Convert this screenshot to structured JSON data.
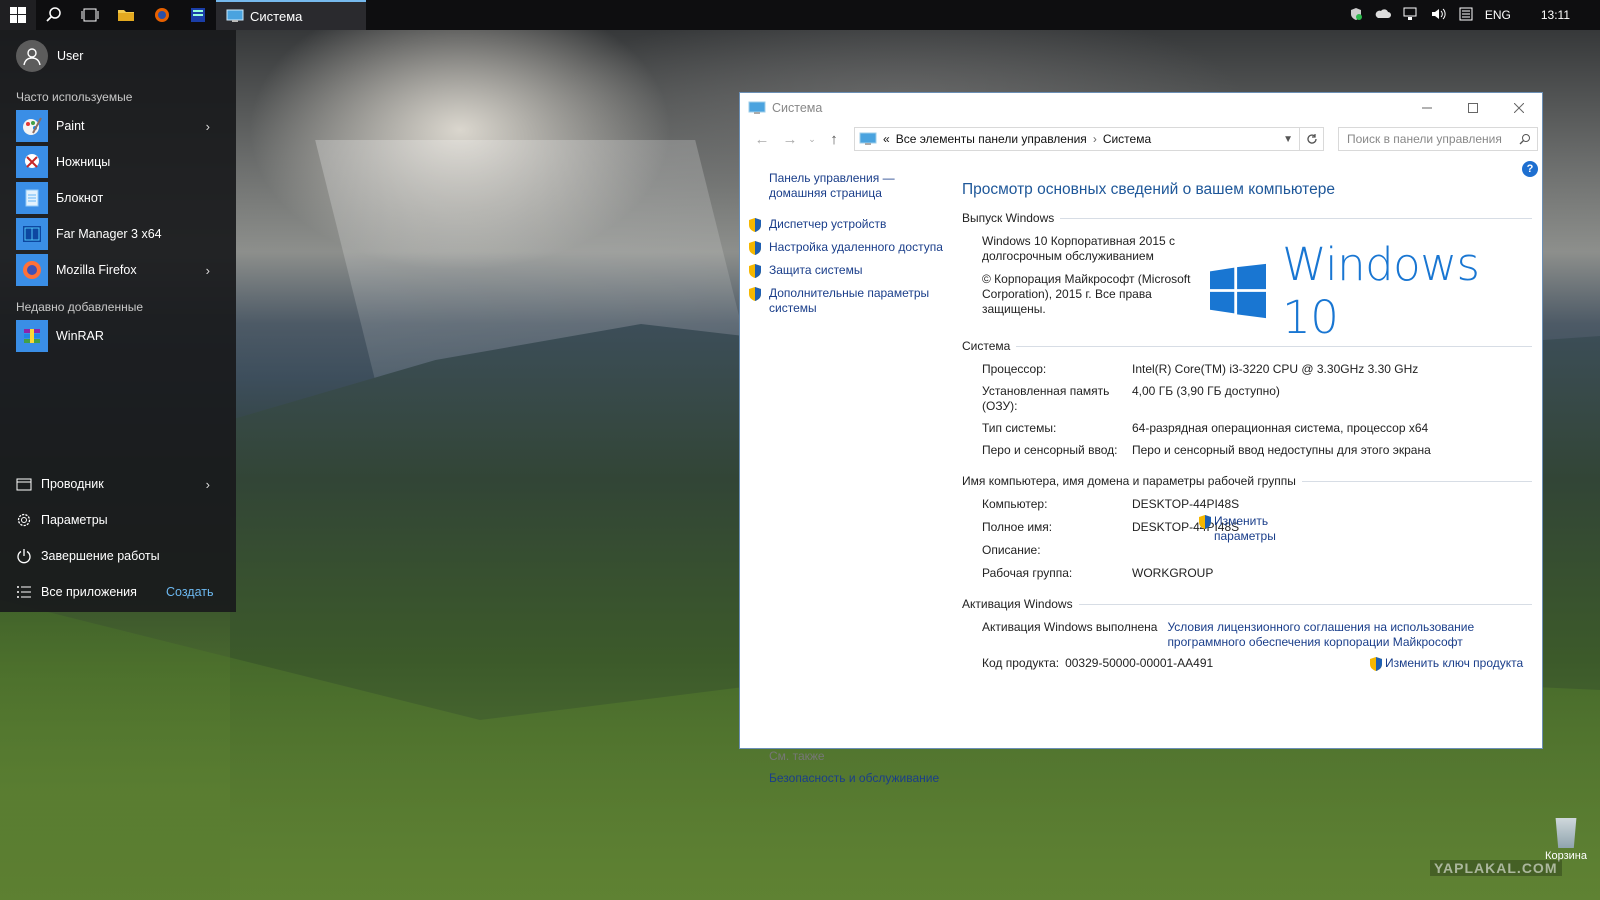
{
  "taskbar": {
    "active_app_label": "Система",
    "tray_language": "ENG",
    "tray_clock": "13:11"
  },
  "start_menu": {
    "user_name": "User",
    "frequent_heading": "Часто используемые",
    "frequent_items": [
      {
        "label": "Paint",
        "icon": "paint-icon",
        "has_arrow": true
      },
      {
        "label": "Ножницы",
        "icon": "snipping-tool-icon",
        "has_arrow": false
      },
      {
        "label": "Блокнот",
        "icon": "notepad-icon",
        "has_arrow": false
      },
      {
        "label": "Far Manager 3 x64",
        "icon": "far-manager-icon",
        "has_arrow": false
      },
      {
        "label": "Mozilla Firefox",
        "icon": "firefox-icon",
        "has_arrow": true
      }
    ],
    "recent_heading": "Недавно добавленные",
    "recent_items": [
      {
        "label": "WinRAR",
        "icon": "winrar-icon"
      }
    ],
    "system_items": [
      {
        "label": "Проводник",
        "icon": "file-explorer-icon",
        "has_arrow": true
      },
      {
        "label": "Параметры",
        "icon": "settings-gear-icon",
        "has_arrow": false
      },
      {
        "label": "Завершение работы",
        "icon": "power-icon",
        "has_arrow": false
      },
      {
        "label": "Все приложения",
        "icon": "all-apps-icon",
        "has_arrow": false
      }
    ],
    "create_label": "Создать"
  },
  "window": {
    "title": "Система",
    "breadcrumb_prefix": "«",
    "breadcrumb": [
      "Все элементы панели управления",
      "Система"
    ],
    "search_placeholder": "Поиск в панели управления",
    "help_label": "?",
    "left_pane": {
      "home_link": "Панель управления — домашняя страница",
      "links": [
        "Диспетчер устройств",
        "Настройка удаленного доступа",
        "Защита системы",
        "Дополнительные параметры системы"
      ],
      "see_also_heading": "См. также",
      "see_also_link": "Безопасность и обслуживание"
    },
    "main_title": "Просмотр основных сведений о вашем компьютере",
    "edition": {
      "heading": "Выпуск Windows",
      "name": "Windows 10 Корпоративная 2015 с долгосрочным обслуживанием",
      "copyright": "© Корпорация Майкрософт (Microsoft Corporation), 2015 г. Все права защищены.",
      "logo_text": "Windows 10"
    },
    "system": {
      "heading": "Система",
      "rows": [
        {
          "key": "Процессор:",
          "value": "Intel(R) Core(TM) i3-3220 CPU @ 3.30GHz   3.30 GHz"
        },
        {
          "key": "Установленная память (ОЗУ):",
          "value": "4,00 ГБ (3,90 ГБ доступно)"
        },
        {
          "key": "Тип системы:",
          "value": "64-разрядная операционная система, процессор x64"
        },
        {
          "key": "Перо и сенсорный ввод:",
          "value": "Перо и сенсорный ввод недоступны для этого экрана"
        }
      ]
    },
    "computer": {
      "heading": "Имя компьютера, имя домена и параметры рабочей группы",
      "rows": [
        {
          "key": "Компьютер:",
          "value": "DESKTOP-44PI48S"
        },
        {
          "key": "Полное имя:",
          "value": "DESKTOP-44PI48S"
        },
        {
          "key": "Описание:",
          "value": ""
        },
        {
          "key": "Рабочая группа:",
          "value": "WORKGROUP"
        }
      ],
      "change_link": "Изменить параметры"
    },
    "activation": {
      "heading": "Активация Windows",
      "status": "Активация Windows выполнена",
      "license_link": "Условия лицензионного соглашения на использование программного обеспечения корпорации Майкрософт",
      "product_key_label": "Код продукта:",
      "product_key": "00329-50000-00001-AA491",
      "change_key_link": "Изменить ключ продукта"
    }
  },
  "desktop": {
    "recycle_bin_label": "Корзина",
    "watermark": "YAPLAKAL.COM"
  },
  "colors": {
    "accent": "#1e5799",
    "link": "#1a3e8a",
    "windows_blue": "#1976d2"
  }
}
